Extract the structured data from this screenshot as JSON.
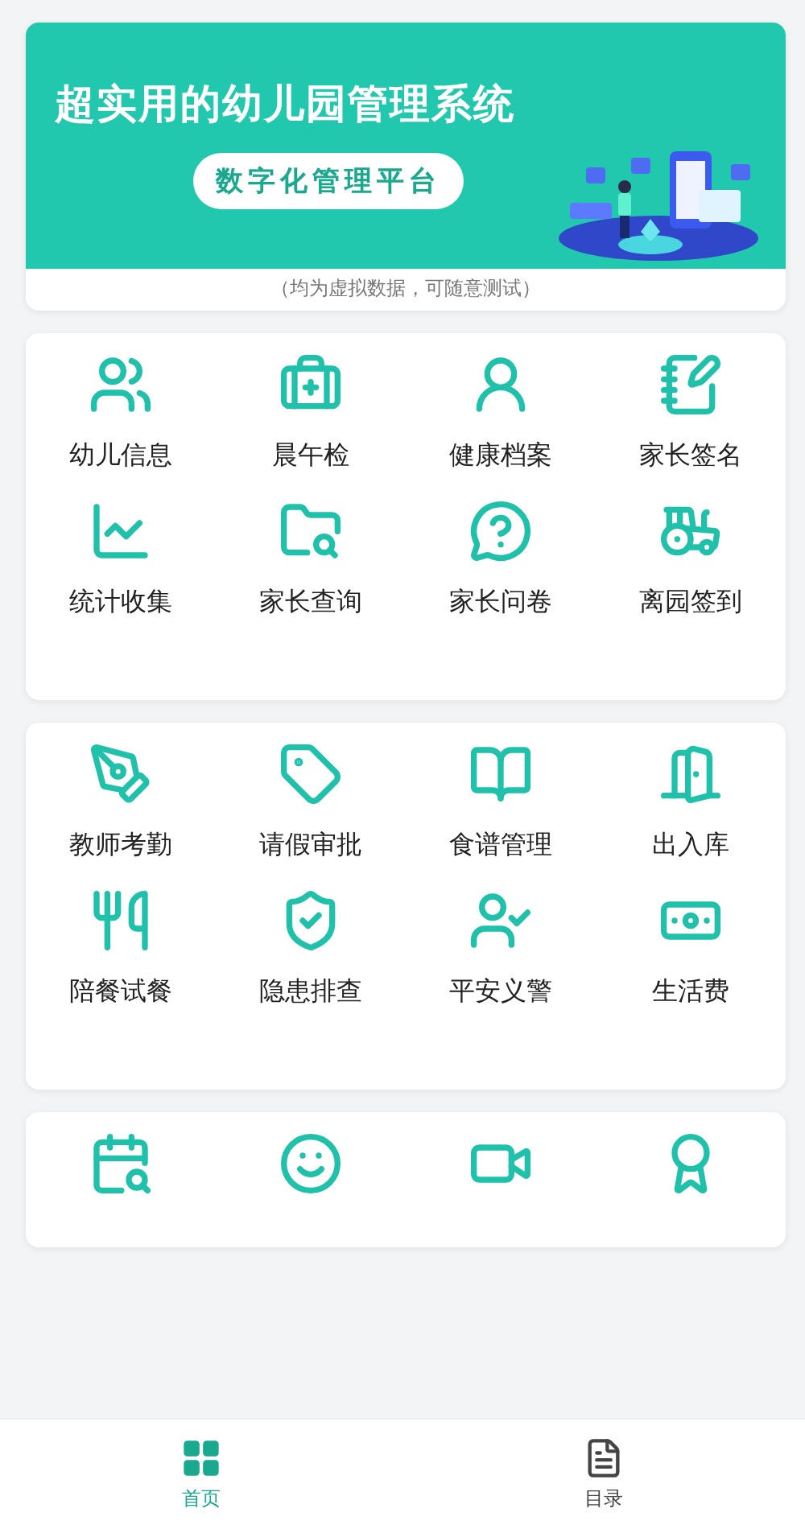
{
  "banner": {
    "title": "超实用的幼儿园管理系统",
    "pill": "数字化管理平台",
    "caption": "（均为虚拟数据，可随意测试）"
  },
  "sections": [
    {
      "items": [
        {
          "kind": "labeled",
          "label": "幼儿信息"
        },
        {
          "kind": "labeled",
          "label": "晨午检"
        },
        {
          "kind": "labeled",
          "label": "健康档案"
        },
        {
          "kind": "labeled",
          "label": "家长签名"
        },
        {
          "kind": "labeled",
          "label": "统计收集"
        },
        {
          "kind": "labeled",
          "label": "家长查询"
        },
        {
          "kind": "labeled",
          "label": "家长问卷"
        },
        {
          "kind": "labeled",
          "label": "离园签到"
        }
      ]
    },
    {
      "items": [
        {
          "kind": "labeled",
          "label": "教师考勤"
        },
        {
          "kind": "labeled",
          "label": "请假审批"
        },
        {
          "kind": "labeled",
          "label": "食谱管理"
        },
        {
          "kind": "labeled",
          "label": "出入库"
        },
        {
          "kind": "labeled",
          "label": "陪餐试餐"
        },
        {
          "kind": "labeled",
          "label": "隐患排查"
        },
        {
          "kind": "labeled",
          "label": "平安义警"
        },
        {
          "kind": "labeled",
          "label": "生活费"
        }
      ]
    },
    {
      "items": [
        {
          "kind": "icon"
        },
        {
          "kind": "icon"
        },
        {
          "kind": "icon"
        },
        {
          "kind": "icon"
        }
      ]
    }
  ],
  "tabs": [
    {
      "label": "首页",
      "selected": true
    },
    {
      "label": "目录",
      "selected": false
    }
  ]
}
